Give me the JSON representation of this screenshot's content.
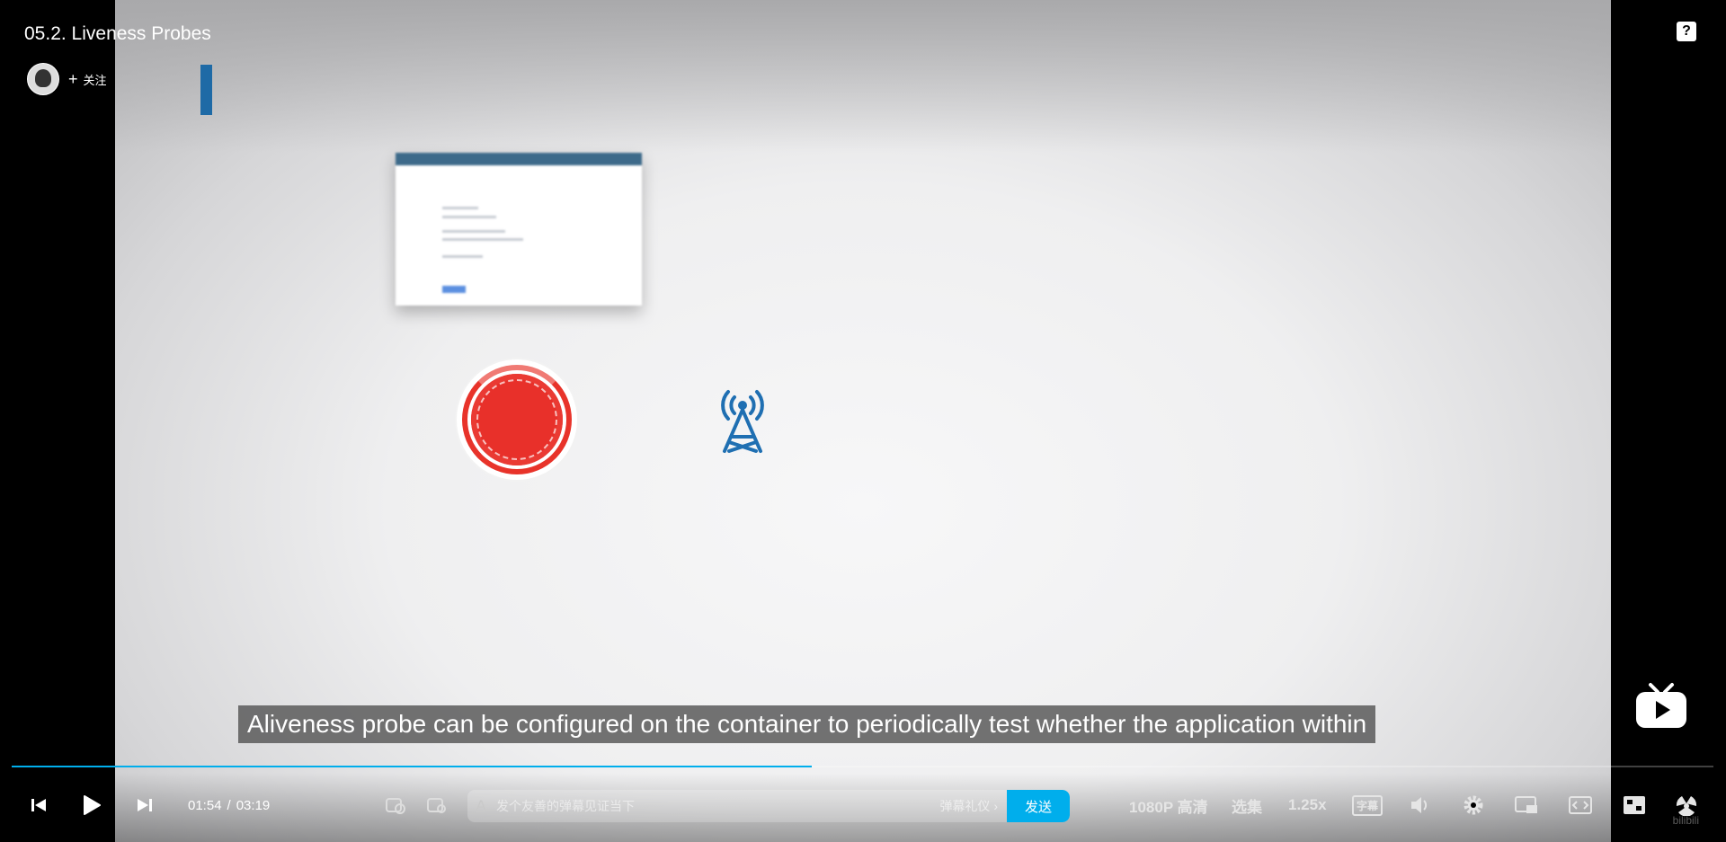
{
  "video": {
    "title": "05.2. Liveness Probes",
    "subtitle": "Aliveness probe can be configured on the container to periodically test whether the application within",
    "progress_fraction": 0.47
  },
  "uploader": {
    "follow_label": "关注",
    "avatar_icon": "avatar-image",
    "plus_icon": "plus-icon"
  },
  "top_right": {
    "help_icon": "question-icon"
  },
  "player": {
    "current_time": "01:54",
    "separator": "/",
    "duration": "03:19",
    "danmaku_placeholder": "发个友善的弹幕见证当下",
    "danmaku_etiquette": "弹幕礼仪 ›",
    "send_label": "发送",
    "quality": "1080P 高清",
    "episodes": "选集",
    "speed": "1.25x",
    "subtitle_badge": "字幕",
    "colors": {
      "accent": "#00aeec",
      "red_button": "#e8302a",
      "tower": "#1f6fb2"
    }
  },
  "watermark": "bilibili"
}
